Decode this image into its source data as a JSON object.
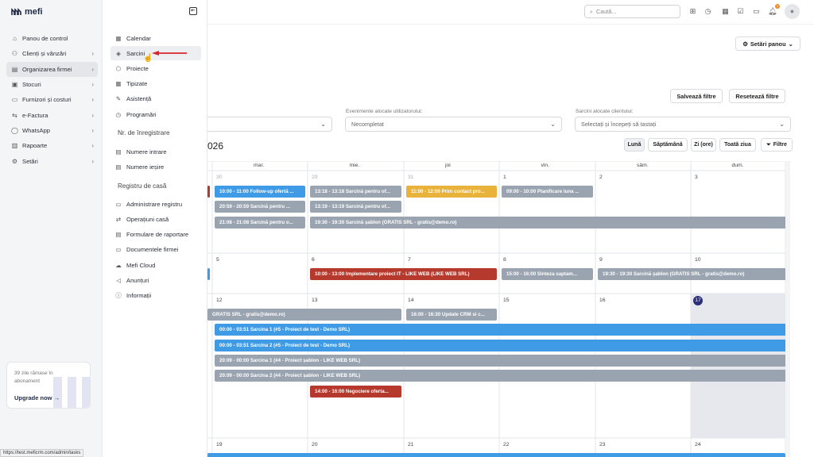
{
  "app": {
    "logo_text": "mefi"
  },
  "sidebar": {
    "items": [
      {
        "icon": "home-icon",
        "label": "Panou de control"
      },
      {
        "icon": "users-icon",
        "label": "Clienți și vânzări",
        "chev": true
      },
      {
        "icon": "building-icon",
        "label": "Organizarea firmei",
        "chev": true,
        "active": true
      },
      {
        "icon": "box-icon",
        "label": "Stocuri",
        "chev": true
      },
      {
        "icon": "wallet-icon",
        "label": "Furnizori și costuri",
        "chev": true
      },
      {
        "icon": "invoice-icon",
        "label": "e-Factura",
        "chev": true
      },
      {
        "icon": "whatsapp-icon",
        "label": "WhatsApp",
        "chev": true
      },
      {
        "icon": "chart-icon",
        "label": "Rapoarte",
        "chev": true
      },
      {
        "icon": "gear-icon",
        "label": "Setări",
        "chev": true
      }
    ],
    "upgrade": {
      "text": "39 zile rămase în abonament",
      "button": "Upgrade now"
    }
  },
  "flyout": {
    "items": [
      {
        "icon": "calendar-icon",
        "label": "Calendar"
      },
      {
        "icon": "layers-icon",
        "label": "Sarcini",
        "highlight": true
      },
      {
        "icon": "cube-icon",
        "label": "Proiecte"
      },
      {
        "icon": "grid-icon",
        "label": "Tipizate"
      },
      {
        "icon": "support-icon",
        "label": "Asistență"
      },
      {
        "icon": "clock-icon",
        "label": "Programări"
      }
    ],
    "section1": "Nr. de înregistrare",
    "items2": [
      {
        "icon": "doc-icon",
        "label": "Numere intrare"
      },
      {
        "icon": "doc-icon",
        "label": "Numere ieșire"
      }
    ],
    "section2": "Registru de casă",
    "items3": [
      {
        "icon": "cash-icon",
        "label": "Administrare registru"
      },
      {
        "icon": "exchange-icon",
        "label": "Operațiuni casă"
      },
      {
        "icon": "form-icon",
        "label": "Formulare de raportare"
      },
      {
        "icon": "folder-icon",
        "label": "Documentele firmei"
      },
      {
        "icon": "cloud-icon",
        "label": "Mefi Cloud"
      },
      {
        "icon": "megaphone-icon",
        "label": "Anunțuri"
      },
      {
        "icon": "info-icon",
        "label": "Informații"
      }
    ]
  },
  "topbar": {
    "search_placeholder": "Caută...",
    "notif_count": "1"
  },
  "toolbar": {
    "settings": "Setări panou",
    "save_filters": "Salvează filtre",
    "reset_filters": "Resetează filtre"
  },
  "filters": {
    "f2_label": "Evenimente alocate utilizatorului:",
    "f2_value": "Necompletat",
    "f3_label": "Sarcini alocate clientului:",
    "f3_value": "Selectați și începeți să tastați"
  },
  "calendar": {
    "year_fragment": "026",
    "views": [
      "Lună",
      "Săptămână",
      "Zi (ore)",
      "Toată ziua"
    ],
    "filter_label": "Filtre",
    "headers": [
      "mar.",
      "mie.",
      "joi",
      "vin.",
      "sâm.",
      "dum."
    ],
    "weeks": [
      [
        "30",
        "29",
        "31",
        "1",
        "2",
        "3"
      ],
      [
        "5",
        "6",
        "7",
        "8",
        "9",
        "10"
      ],
      [
        "12",
        "13",
        "14",
        "15",
        "16",
        "17"
      ],
      [
        "19",
        "20",
        "21",
        "22",
        "23",
        "24"
      ]
    ],
    "today": "17",
    "events": [
      {
        "row": 0,
        "col": 0,
        "span": 1,
        "lane": 0,
        "color": "blue",
        "text": "10:00 - 11:00 Follow-up ofertă ..."
      },
      {
        "row": 0,
        "col": 0,
        "span": 1,
        "lane": 1,
        "color": "gray",
        "text": "20:59 - 20:59 Sarcină pentru ..."
      },
      {
        "row": 0,
        "col": 0,
        "span": 1,
        "lane": 2,
        "color": "gray",
        "text": "21:08 - 21:08 Sarcină pentru o..."
      },
      {
        "row": 0,
        "col": 1,
        "span": 1,
        "lane": 0,
        "color": "gray",
        "text": "13:18 - 13:18 Sarcină pentru of..."
      },
      {
        "row": 0,
        "col": 1,
        "span": 1,
        "lane": 1,
        "color": "gray",
        "text": "13:19 - 13:19 Sarcină pentru of..."
      },
      {
        "row": 0,
        "col": 2,
        "span": 1,
        "lane": 0,
        "color": "yellow",
        "text": "11:00 - 12:00 Prim contact pro..."
      },
      {
        "row": 0,
        "col": 3,
        "span": 1,
        "lane": 0,
        "color": "gray",
        "text": "09:00 - 10:00 Planificare luna ..."
      },
      {
        "row": 0,
        "col": 1,
        "span": 5,
        "lane": 2,
        "color": "gray",
        "text": "19:30 - 19:30 Sarcină șablon (GRATIS SRL - gratis@demo.ro)"
      },
      {
        "row": 1,
        "col": 1,
        "span": 2,
        "lane": 0,
        "color": "red",
        "text": "10:00 - 13:00 Implementare proiect IT - LIKE WEB (LIKE WEB SRL)"
      },
      {
        "row": 1,
        "col": 3,
        "span": 1,
        "lane": 0,
        "color": "gray",
        "text": "15:00 - 16:00 Sinteza saptam..."
      },
      {
        "row": 1,
        "col": 4,
        "span": 2,
        "lane": 0,
        "color": "gray",
        "text": "19:30 - 19:30 Sarcină șablon (GRATIS SRL - gratis@demo.ro)"
      },
      {
        "row": 2,
        "col": 0,
        "span": 2,
        "lane": 0,
        "color": "gray",
        "text": "GRATIS SRL - gratis@demo.ro)"
      },
      {
        "row": 2,
        "col": 2,
        "span": 1,
        "lane": 0,
        "color": "gray",
        "text": "16:00 - 16:30 Update CRM si c..."
      },
      {
        "row": 2,
        "col": 0,
        "span": 6,
        "lane": 1,
        "color": "blue",
        "text": "00:00 - 03:51 Sarcina 1 (#5 - Proiect de test - Demo SRL)"
      },
      {
        "row": 2,
        "col": 0,
        "span": 6,
        "lane": 2,
        "color": "blue",
        "text": "00:00 - 03:51 Sarcina 2 (#5 - Proiect de test - Demo SRL)"
      },
      {
        "row": 2,
        "col": 0,
        "span": 6,
        "lane": 3,
        "color": "gray",
        "text": "20:09 - 00:00 Sarcina 1 (#4 - Proiect șablon - LIKE WEB SRL)"
      },
      {
        "row": 2,
        "col": 0,
        "span": 6,
        "lane": 4,
        "color": "gray",
        "text": "20:09 - 00:00 Sarcina 2 (#4 - Proiect șablon - LIKE WEB SRL)"
      },
      {
        "row": 2,
        "col": 1,
        "span": 1,
        "lane": 5,
        "color": "red",
        "text": "14:00 - 16:00 Negociere oferta..."
      }
    ]
  },
  "status_url": "https://test.meficrm.com/admin/tasks"
}
